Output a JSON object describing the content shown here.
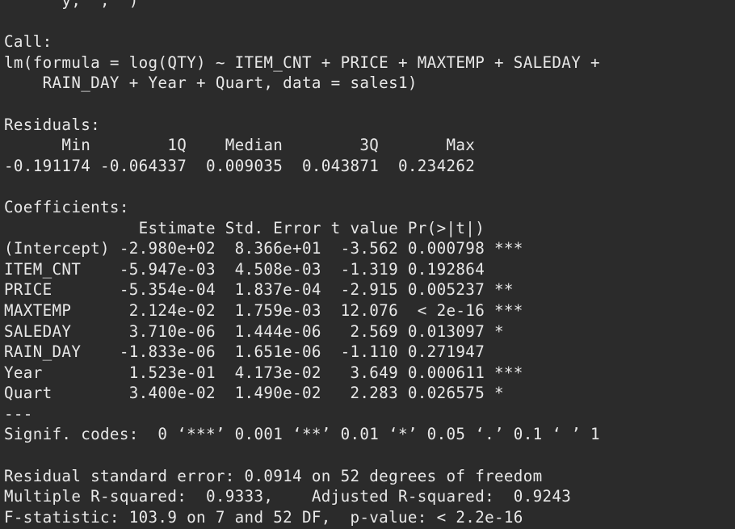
{
  "console": {
    "lines": [
      "      y,  ,  )",
      "",
      "Call:",
      "lm(formula = log(QTY) ~ ITEM_CNT + PRICE + MAXTEMP + SALEDAY +",
      "    RAIN_DAY + Year + Quart, data = sales1)",
      "",
      "Residuals:",
      "      Min        1Q    Median        3Q       Max",
      "-0.191174 -0.064337  0.009035  0.043871  0.234262",
      "",
      "Coefficients:",
      "              Estimate Std. Error t value Pr(>|t|)",
      "(Intercept) -2.980e+02  8.366e+01  -3.562 0.000798 ***",
      "ITEM_CNT    -5.947e-03  4.508e-03  -1.319 0.192864",
      "PRICE       -5.354e-04  1.837e-04  -2.915 0.005237 **",
      "MAXTEMP      2.124e-02  1.759e-03  12.076  < 2e-16 ***",
      "SALEDAY      3.710e-06  1.444e-06   2.569 0.013097 *",
      "RAIN_DAY    -1.833e-06  1.651e-06  -1.110 0.271947",
      "Year         1.523e-01  4.173e-02   3.649 0.000611 ***",
      "Quart        3.400e-02  1.490e-02   2.283 0.026575 *",
      "---",
      "Signif. codes:  0 ‘***’ 0.001 ‘**’ 0.01 ‘*’ 0.05 ‘.’ 0.1 ‘ ’ 1",
      "",
      "Residual standard error: 0.0914 on 52 degrees of freedom",
      "Multiple R-squared:  0.9333,\tAdjusted R-squared:  0.9243",
      "F-statistic: 103.9 on 7 and 52 DF,  p-value: < 2.2e-16"
    ]
  }
}
